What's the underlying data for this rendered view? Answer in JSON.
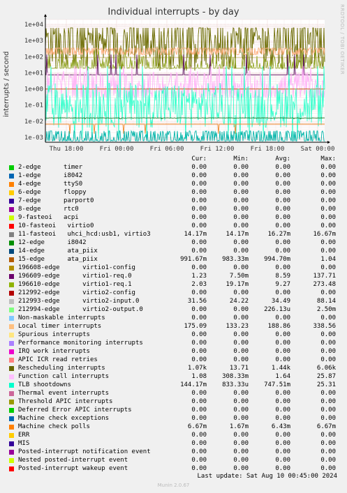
{
  "title": "Individual interrupts - by day",
  "credit": "RRDTOOL / TOBI OETIKER",
  "ylabel": "interrupts / second",
  "chart_data": {
    "type": "line",
    "y_scale": "log",
    "ylim": [
      0.0005,
      20000
    ],
    "y_ticks": [
      "1e-03",
      "1e-02",
      "1e-01",
      "1e+00",
      "1e+01",
      "1e+02",
      "1e+03",
      "1e+04"
    ],
    "x_ticks": [
      "Thu 18:00",
      "Fri 00:00",
      "Fri 06:00",
      "Fri 12:00",
      "Fri 18:00",
      "Sat 00:00"
    ],
    "grid": true,
    "series": [
      {
        "name": "212993-edge",
        "color": "#DAD8A0",
        "level": 1000,
        "jitter": 1.0,
        "min": 24.22,
        "max": 88.14
      },
      {
        "name": "Rescheduling interrupts",
        "color": "#6B6B00",
        "level": 800,
        "jitter": 1.7,
        "min": 13.71,
        "max": 6060
      },
      {
        "name": "Local timer interrupts",
        "color": "#FFB07F",
        "level": 250,
        "jitter": 0.5,
        "min": 133.23,
        "max": 338.56
      },
      {
        "name": "196610-edge",
        "color": "#95A82A",
        "level": 8,
        "jitter": 1.2,
        "min": 19.17,
        "max": 273.48
      },
      {
        "name": "196609-edge",
        "color": "#5B0F5F",
        "level": 1.0,
        "jitter": 0.9,
        "min": 7.5,
        "max": 137.71
      },
      {
        "name": "Function call interrupts",
        "color": "#FFB3F7",
        "level": 1.3,
        "jitter": 1.0,
        "min": 0.30833,
        "max": 25.87
      },
      {
        "name": "15-edge",
        "color": "#B95B00",
        "level": 0.99,
        "jitter": 0.02,
        "min": 0.98333,
        "max": 1.04
      },
      {
        "name": "TLB shootdowns",
        "color": "#33FFCC",
        "level": 0.1,
        "jitter": 1.4,
        "min": 0.000833,
        "max": 25.31
      },
      {
        "name": "11-fasteoi",
        "color": "#1C6E1C",
        "level": 0.016,
        "jitter": 0.05,
        "min": 0.01417,
        "max": 0.01667
      },
      {
        "name": "Machine check polls",
        "color": "#F0892A",
        "level": 0.0067,
        "jitter": 0.05,
        "min": 0.00167,
        "max": 0.00667
      },
      {
        "name": "212994-edge",
        "color": "#00B3A8",
        "level": 0.0008,
        "jitter": 0.8,
        "min": 0,
        "max": 0.0025
      }
    ]
  },
  "legend": {
    "columns": [
      "Cur:",
      "Min:",
      "Avg:",
      "Max:"
    ],
    "rows": [
      {
        "label": "2-edge      timer",
        "color": "#00CC00",
        "cur": "0.00",
        "min": "0.00",
        "avg": "0.00",
        "max": "0.00"
      },
      {
        "label": "1-edge      i8042",
        "color": "#0066B3",
        "cur": "0.00",
        "min": "0.00",
        "avg": "0.00",
        "max": "0.00"
      },
      {
        "label": "4-edge      ttyS0",
        "color": "#FF8000",
        "cur": "0.00",
        "min": "0.00",
        "avg": "0.00",
        "max": "0.00"
      },
      {
        "label": "6-edge      floppy",
        "color": "#FFCC00",
        "cur": "0.00",
        "min": "0.00",
        "avg": "0.00",
        "max": "0.00"
      },
      {
        "label": "7-edge      parport0",
        "color": "#330099",
        "cur": "0.00",
        "min": "0.00",
        "avg": "0.00",
        "max": "0.00"
      },
      {
        "label": "8-edge      rtc0",
        "color": "#990099",
        "cur": "0.00",
        "min": "0.00",
        "avg": "0.00",
        "max": "0.00"
      },
      {
        "label": "9-fasteoi   acpi",
        "color": "#CCFF00",
        "cur": "0.00",
        "min": "0.00",
        "avg": "0.00",
        "max": "0.00"
      },
      {
        "label": "10-fasteoi   virtio0",
        "color": "#FF0000",
        "cur": "0.00",
        "min": "0.00",
        "avg": "0.00",
        "max": "0.00"
      },
      {
        "label": "11-fasteoi   uhci_hcd:usb1, virtio3",
        "color": "#808080",
        "cur": "14.17m",
        "min": "14.17m",
        "avg": "16.27m",
        "max": "16.67m"
      },
      {
        "label": "12-edge      i8042",
        "color": "#008F00",
        "cur": "0.00",
        "min": "0.00",
        "avg": "0.00",
        "max": "0.00"
      },
      {
        "label": "14-edge      ata_piix",
        "color": "#00487D",
        "cur": "0.00",
        "min": "0.00",
        "avg": "0.00",
        "max": "0.00"
      },
      {
        "label": "15-edge      ata_piix",
        "color": "#B35A00",
        "cur": "991.67m",
        "min": "983.33m",
        "avg": "994.70m",
        "max": "1.04"
      },
      {
        "label": "196608-edge      virtio1-config",
        "color": "#B38F00",
        "cur": "0.00",
        "min": "0.00",
        "avg": "0.00",
        "max": "0.00"
      },
      {
        "label": "196609-edge      virtio1-req.0",
        "color": "#6B006B",
        "cur": "1.23",
        "min": "7.50m",
        "avg": "8.59",
        "max": "137.71"
      },
      {
        "label": "196610-edge      virtio1-req.1",
        "color": "#8FB300",
        "cur": "2.03",
        "min": "19.17m",
        "avg": "9.27",
        "max": "273.48"
      },
      {
        "label": "212992-edge      virtio2-config",
        "color": "#B30000",
        "cur": "0.00",
        "min": "0.00",
        "avg": "0.00",
        "max": "0.00"
      },
      {
        "label": "212993-edge      virtio2-input.0",
        "color": "#BEBEBE",
        "cur": "31.56",
        "min": "24.22",
        "avg": "34.49",
        "max": "88.14"
      },
      {
        "label": "212994-edge      virtio2-output.0",
        "color": "#80FF80",
        "cur": "0.00",
        "min": "0.00",
        "avg": "226.13u",
        "max": "2.50m"
      },
      {
        "label": "Non-maskable interrupts",
        "color": "#80C9FF",
        "cur": "0.00",
        "min": "0.00",
        "avg": "0.00",
        "max": "0.00"
      },
      {
        "label": "Local timer interrupts",
        "color": "#FFC080",
        "cur": "175.09",
        "min": "133.23",
        "avg": "188.86",
        "max": "338.56"
      },
      {
        "label": "Spurious interrupts",
        "color": "#FFE680",
        "cur": "0.00",
        "min": "0.00",
        "avg": "0.00",
        "max": "0.00"
      },
      {
        "label": "Performance monitoring interrupts",
        "color": "#AA80FF",
        "cur": "0.00",
        "min": "0.00",
        "avg": "0.00",
        "max": "0.00"
      },
      {
        "label": "IRQ work interrupts",
        "color": "#EE00CC",
        "cur": "0.00",
        "min": "0.00",
        "avg": "0.00",
        "max": "0.00"
      },
      {
        "label": "APIC ICR read retries",
        "color": "#FF8080",
        "cur": "0.00",
        "min": "0.00",
        "avg": "0.00",
        "max": "0.00"
      },
      {
        "label": "Rescheduling interrupts",
        "color": "#666600",
        "cur": "1.07k",
        "min": "13.71",
        "avg": "1.44k",
        "max": "6.06k"
      },
      {
        "label": "Function call interrupts",
        "color": "#FFBFFF",
        "cur": "1.08",
        "min": "308.33m",
        "avg": "1.64",
        "max": "25.87"
      },
      {
        "label": "TLB shootdowns",
        "color": "#00FFCC",
        "cur": "144.17m",
        "min": "833.33u",
        "avg": "747.51m",
        "max": "25.31"
      },
      {
        "label": "Thermal event interrupts",
        "color": "#CC6699",
        "cur": "0.00",
        "min": "0.00",
        "avg": "0.00",
        "max": "0.00"
      },
      {
        "label": "Threshold APIC interrupts",
        "color": "#999900",
        "cur": "0.00",
        "min": "0.00",
        "avg": "0.00",
        "max": "0.00"
      },
      {
        "label": "Deferred Error APIC interrupts",
        "color": "#00CC00",
        "cur": "0.00",
        "min": "0.00",
        "avg": "0.00",
        "max": "0.00"
      },
      {
        "label": "Machine check exceptions",
        "color": "#0066B3",
        "cur": "0.00",
        "min": "0.00",
        "avg": "0.00",
        "max": "0.00"
      },
      {
        "label": "Machine check polls",
        "color": "#FF8000",
        "cur": "6.67m",
        "min": "1.67m",
        "avg": "6.43m",
        "max": "6.67m"
      },
      {
        "label": "ERR",
        "color": "#FFCC00",
        "cur": "0.00",
        "min": "0.00",
        "avg": "0.00",
        "max": "0.00"
      },
      {
        "label": "MIS",
        "color": "#330099",
        "cur": "0.00",
        "min": "0.00",
        "avg": "0.00",
        "max": "0.00"
      },
      {
        "label": "Posted-interrupt notification event",
        "color": "#990099",
        "cur": "0.00",
        "min": "0.00",
        "avg": "0.00",
        "max": "0.00"
      },
      {
        "label": "Nested posted-interrupt event",
        "color": "#CCFF00",
        "cur": "0.00",
        "min": "0.00",
        "avg": "0.00",
        "max": "0.00"
      },
      {
        "label": "Posted-interrupt wakeup event",
        "color": "#FF0000",
        "cur": "0.00",
        "min": "0.00",
        "avg": "0.00",
        "max": "0.00"
      }
    ]
  },
  "last_update": "Last update: Sat Aug 10 00:45:00 2024",
  "footer": "Munin 2.0.67"
}
